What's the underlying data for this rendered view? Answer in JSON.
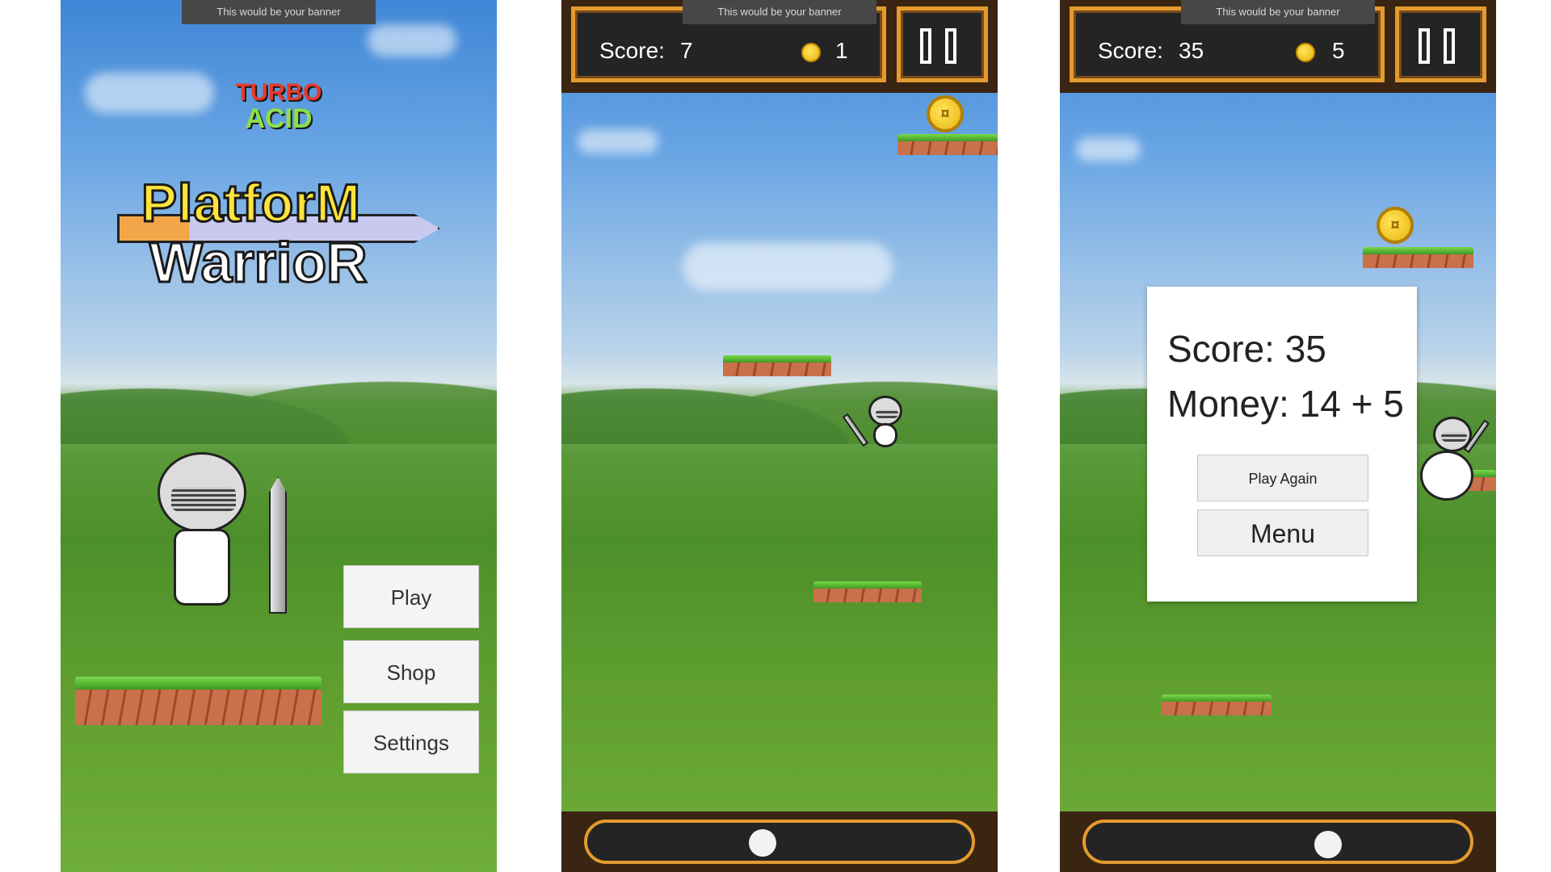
{
  "banner_text": "This would be your banner",
  "screen1": {
    "logo_top": "TURBO",
    "logo_bottom": "ACID",
    "title_line1": "PlatforM",
    "title_line2": "WarrioR",
    "buttons": {
      "play": "Play",
      "shop": "Shop",
      "settings": "Settings"
    }
  },
  "screen2": {
    "score_label": "Score:",
    "score": "7",
    "coins": "1",
    "coin_symbol": "¤"
  },
  "screen3": {
    "score_label": "Score:",
    "score": "35",
    "coins": "5",
    "coin_symbol": "¤",
    "dialog": {
      "score_line": "Score: 35",
      "money_line": "Money: 14 + 5",
      "play_again": "Play Again",
      "menu": "Menu"
    }
  },
  "icons": {
    "pause": "pause-icon",
    "coin": "coin-icon",
    "joystick": "joystick-knob-icon"
  },
  "colors": {
    "hud_border": "#e39b2e",
    "hud_bg": "#242424",
    "coin": "#f5c518",
    "grass": "#5cc02e"
  }
}
